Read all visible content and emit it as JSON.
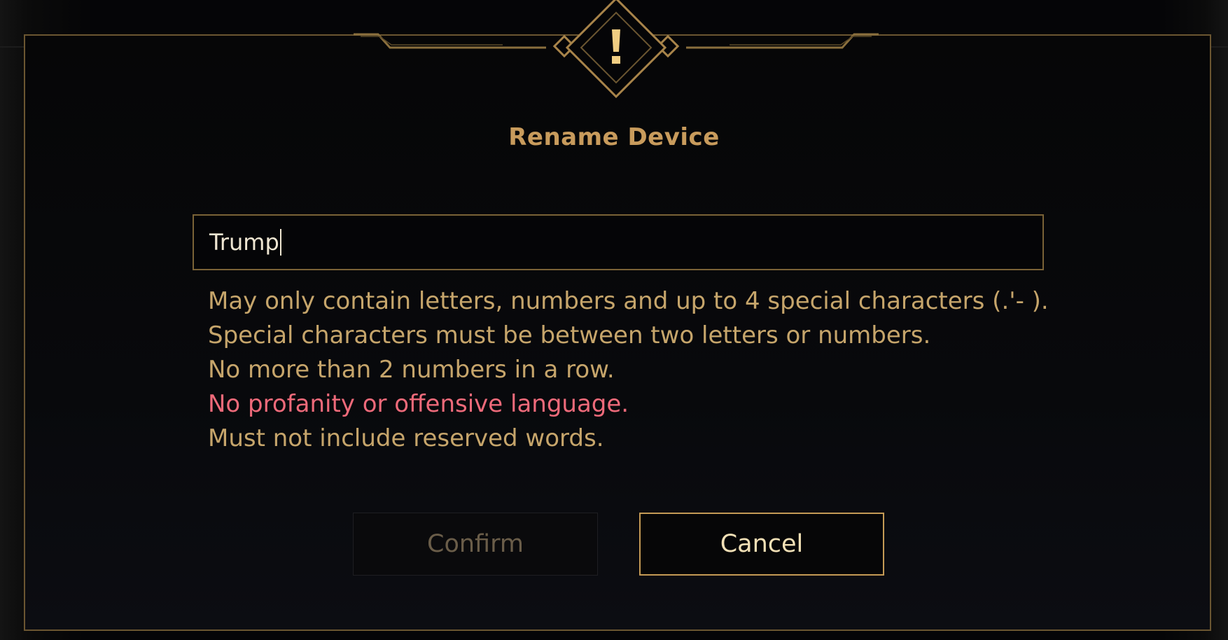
{
  "dialog": {
    "title": "Rename Device",
    "icon": "exclamation-icon",
    "accent_color": "#c89b5c",
    "error_color": "#ee6a7a"
  },
  "name_field": {
    "value": "Trump"
  },
  "rules": [
    {
      "text": "May only contain letters, numbers and up to 4 special characters (.'- ).",
      "violated": false
    },
    {
      "text": "Special characters must be between two letters or numbers.",
      "violated": false
    },
    {
      "text": "No more than 2 numbers in a row.",
      "violated": false
    },
    {
      "text": "No profanity or offensive language.",
      "violated": true
    },
    {
      "text": "Must not include reserved words.",
      "violated": false
    }
  ],
  "buttons": {
    "confirm_label": "Confirm",
    "confirm_enabled": false,
    "cancel_label": "Cancel"
  }
}
